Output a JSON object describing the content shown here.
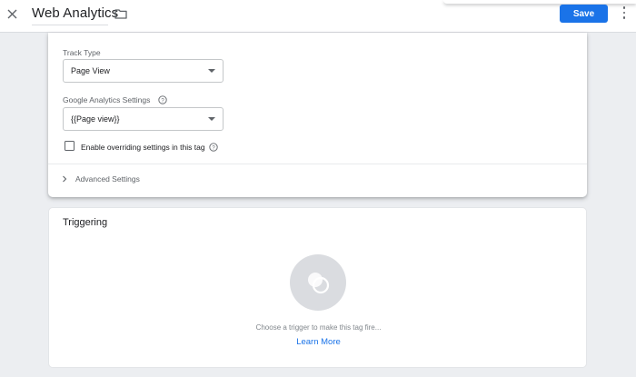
{
  "topbar": {
    "close_icon": "close-icon",
    "title": "Web Analytics",
    "folder_icon": "folder-icon",
    "save_label": "Save",
    "more_icon": "more-vert-icon"
  },
  "config": {
    "track_type": {
      "label": "Track Type",
      "value": "Page View"
    },
    "ga_settings": {
      "label": "Google Analytics Settings",
      "value": "{{Page view}}"
    },
    "override": {
      "label": "Enable overriding settings in this tag",
      "checked": false
    },
    "advanced": {
      "label": "Advanced Settings"
    }
  },
  "triggering": {
    "title": "Triggering",
    "hint": "Choose a trigger to make this tag fire...",
    "learn_more": "Learn More"
  },
  "colors": {
    "accent": "#1a73e8",
    "page_bg": "#eceef1"
  }
}
